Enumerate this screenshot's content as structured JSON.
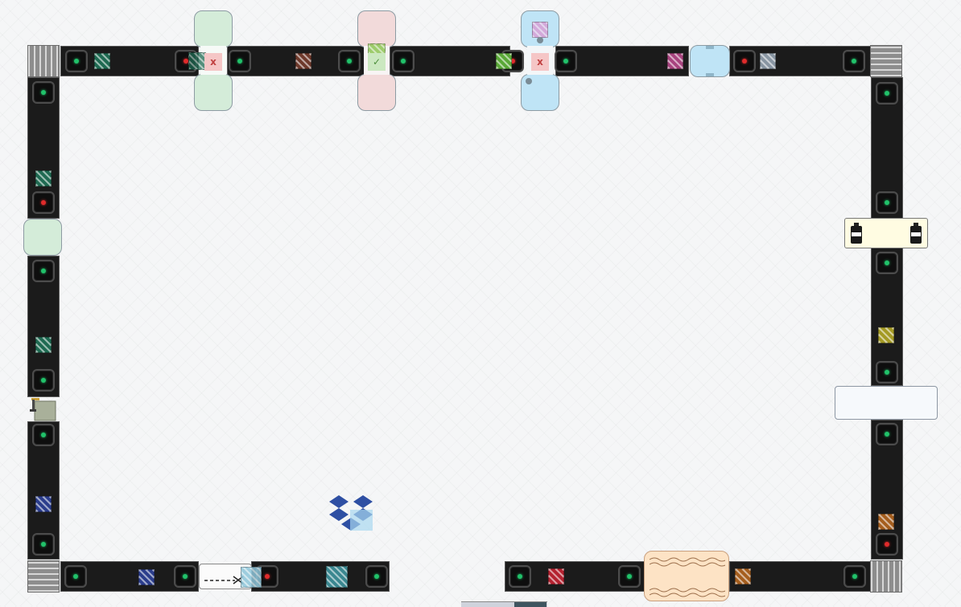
{
  "game": {
    "type": "conveyor-sorting",
    "track": "rectangular-loop",
    "colors": {
      "belt": "#1b1b1b",
      "sensor_active": "#21c26a",
      "sensor_alert": "#e02b2b",
      "station_green": "#d4ecd9",
      "station_red": "#f2dada",
      "station_blue": "#bfe4f6",
      "station_orange": "#fde3c5",
      "station_yellow": "#fffce2"
    },
    "stations": {
      "top_green": {
        "color": "green",
        "indicator": "x"
      },
      "top_red": {
        "color": "red",
        "indicator": "check"
      },
      "top_blue": {
        "color": "blue",
        "indicator": "x"
      },
      "top_right_blue": {
        "color": "blue"
      },
      "left_green": {
        "color": "green"
      },
      "right_yellow": {
        "color": "yellow",
        "icon": "spray-can-icon"
      },
      "right_blank": {
        "color": "white"
      },
      "bottom_scissors": {
        "icon": "scissors-icon"
      },
      "bottom_orange": {
        "color": "orange",
        "pattern": "wave"
      }
    },
    "loose_item": {
      "icon": "dropbox-icon"
    }
  }
}
